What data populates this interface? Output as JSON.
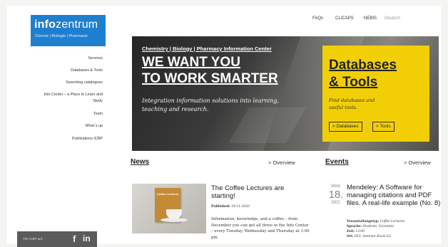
{
  "logo": {
    "brand_bold": "info",
    "brand_light": "zentrum",
    "tagline": "Chemie | Biologie | Pharmazie"
  },
  "top_nav": [
    "FAQs",
    "CLICAPS",
    "NEBIS",
    "Deutsch"
  ],
  "sidebar": {
    "items": [
      "Services",
      "Databases & Tools",
      "Searching catalogues",
      "Info Center – a Place to Learn and",
      "Study",
      "Team",
      "What`s up",
      "Publications ICBP"
    ],
    "social_label": "The ICBP auf:",
    "social_icons": [
      "facebook-icon",
      "linkedin-icon"
    ]
  },
  "hero": {
    "kicker": "Chemistry | Biology | Pharmacy Information Center",
    "headline_1": "WE WANT YOU",
    "headline_2": "TO WORK SMARTER",
    "subline": "Integration information solutions into learning, teaching and research."
  },
  "db_box": {
    "title_1": "Databases",
    "title_2": "& Tools",
    "desc": "Find databases and useful tools.",
    "btn_databases": "> Databases",
    "btn_tools": "> Tools",
    "color": "#f2cf05"
  },
  "news": {
    "heading": "News",
    "overview": "> Overview",
    "title": "The Coffee Lectures are starting!",
    "published_label": "Published:",
    "published_date": "29.11.2020",
    "body": "Information, knowledge, and a coffee – from December you can get all three in the Info Center – every Tuesday, Wednesday and Thursday at 1:00 pm.",
    "image_text": "Coffee Lectures"
  },
  "events": {
    "heading": "Events",
    "overview": "> Overview",
    "weekday": "Wed.",
    "day": "18.",
    "month": "DEC",
    "title": "Mendeley: A Software for managing citations and PDF files. A real-life example (No. 8)",
    "meta": {
      "type_label": "Veranstaltungstyp:",
      "type_value": "Coffee Lectures",
      "audience_label": "Sprache:",
      "audience_value": "Students, Scientists",
      "time_label": "Zeit:",
      "time_value": "13:00",
      "place_label": "Ort:",
      "place_value": "HCI, Seminar Room G2"
    }
  },
  "colors": {
    "brand_blue": "#1f7fcf",
    "accent_yellow": "#f2cf05"
  }
}
